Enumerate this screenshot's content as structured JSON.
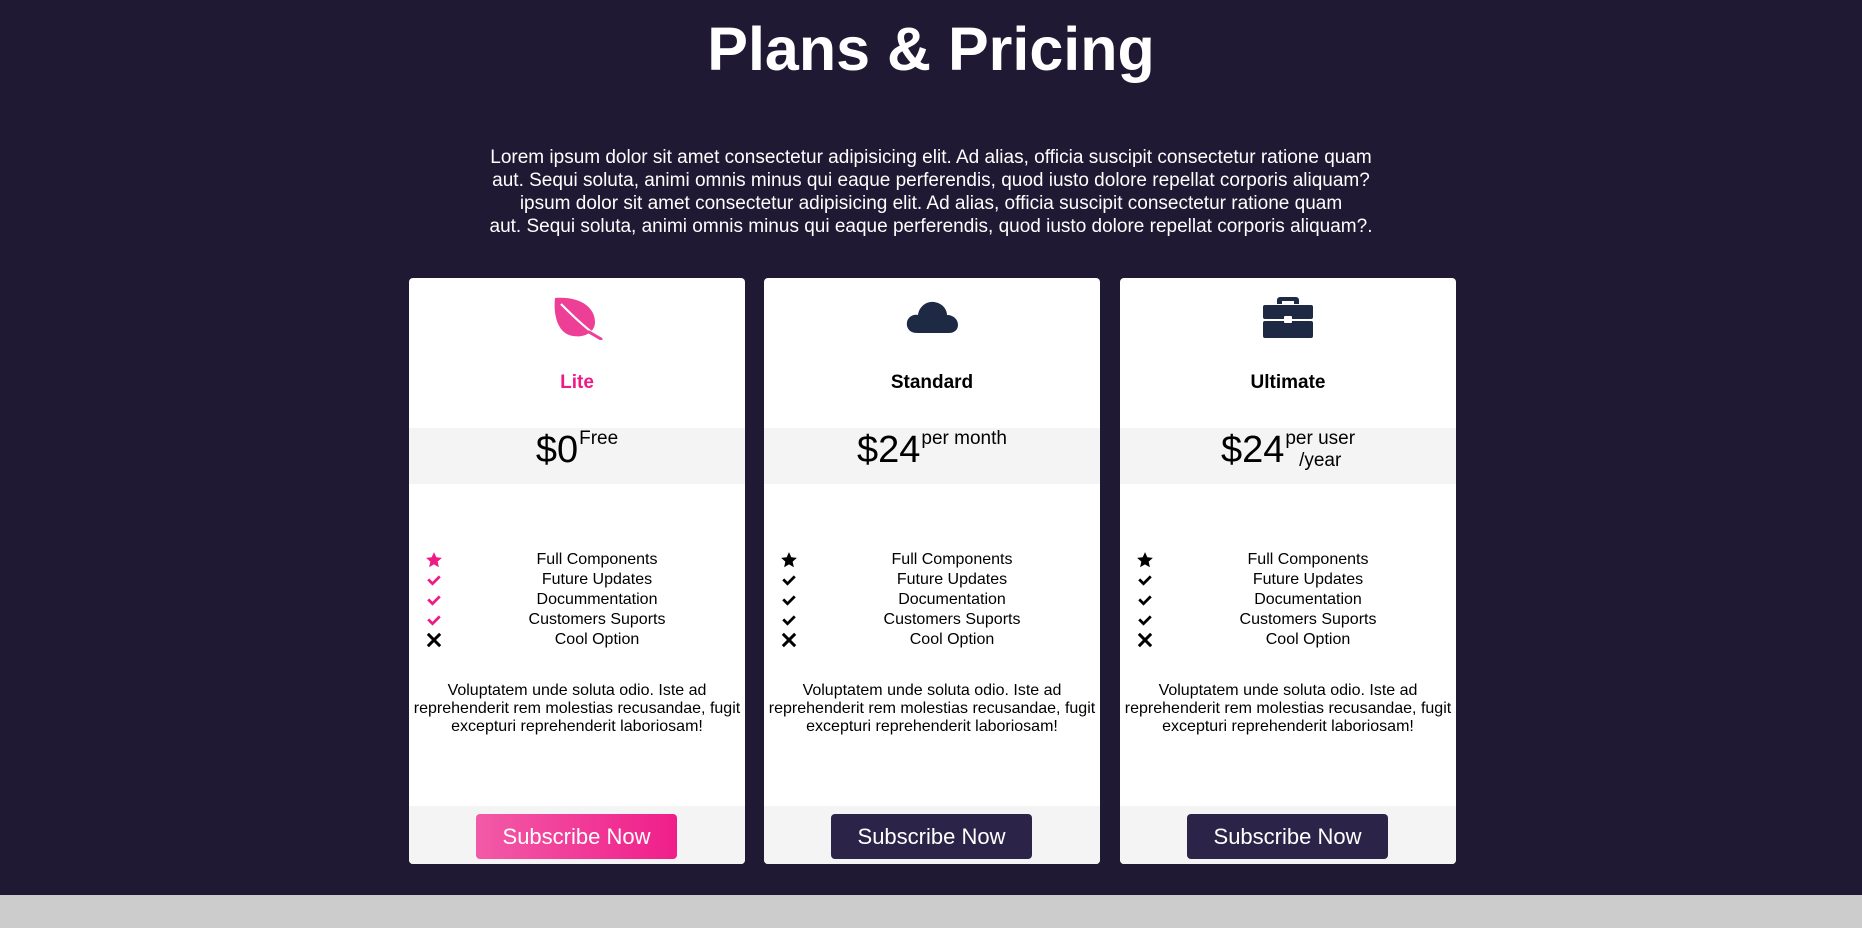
{
  "page": {
    "title": "Plans & Pricing",
    "intro_lines": [
      "Lorem ipsum dolor sit amet consectetur adipisicing elit. Ad alias, officia suscipit consectetur ratione quam",
      "aut. Sequi soluta, animi omnis minus qui eaque perferendis, quod iusto dolore repellat corporis aliquam?",
      "ipsum dolor sit amet consectetur adipisicing elit. Ad alias, officia suscipit consectetur ratione quam",
      "aut. Sequi soluta, animi omnis minus qui eaque perferendis, quod iusto dolore repellat corporis aliquam?."
    ]
  },
  "colors": {
    "background": "#1f1933",
    "accent": "#ee1b86",
    "dark_button": "#2c2448",
    "icon_dark": "#1e2a44"
  },
  "plans": [
    {
      "icon": "leaf-icon",
      "name": "Lite",
      "price": "$0",
      "period": "Free",
      "features": [
        {
          "icon": "star-icon",
          "label": "Full Components"
        },
        {
          "icon": "check-icon",
          "label": "Future Updates"
        },
        {
          "icon": "check-icon",
          "label": "Docummentation"
        },
        {
          "icon": "check-icon",
          "label": "Customers Suports"
        },
        {
          "icon": "x-icon",
          "label": "Cool Option"
        }
      ],
      "description": "Voluptatem unde soluta odio. Iste ad reprehenderit rem molestias recusandae, fugit excepturi reprehenderit laboriosam!",
      "button": "Subscribe Now"
    },
    {
      "icon": "cloud-icon",
      "name": "Standard",
      "price": "$24",
      "period": "per month",
      "features": [
        {
          "icon": "star-icon",
          "label": "Full Components"
        },
        {
          "icon": "check-icon",
          "label": "Future Updates"
        },
        {
          "icon": "check-icon",
          "label": "Documentation"
        },
        {
          "icon": "check-icon",
          "label": "Customers Suports"
        },
        {
          "icon": "x-icon",
          "label": "Cool Option"
        }
      ],
      "description": "Voluptatem unde soluta odio. Iste ad reprehenderit rem molestias recusandae, fugit excepturi reprehenderit laboriosam!",
      "button": "Subscribe Now"
    },
    {
      "icon": "briefcase-icon",
      "name": "Ultimate",
      "price": "$24",
      "period_line1": "per user",
      "period_line2": "/year",
      "features": [
        {
          "icon": "star-icon",
          "label": "Full Components"
        },
        {
          "icon": "check-icon",
          "label": "Future Updates"
        },
        {
          "icon": "check-icon",
          "label": "Documentation"
        },
        {
          "icon": "check-icon",
          "label": "Customers Suports"
        },
        {
          "icon": "x-icon",
          "label": "Cool Option"
        }
      ],
      "description": "Voluptatem unde soluta odio. Iste ad reprehenderit rem molestias recusandae, fugit excepturi reprehenderit laboriosam!",
      "button": "Subscribe Now"
    }
  ]
}
